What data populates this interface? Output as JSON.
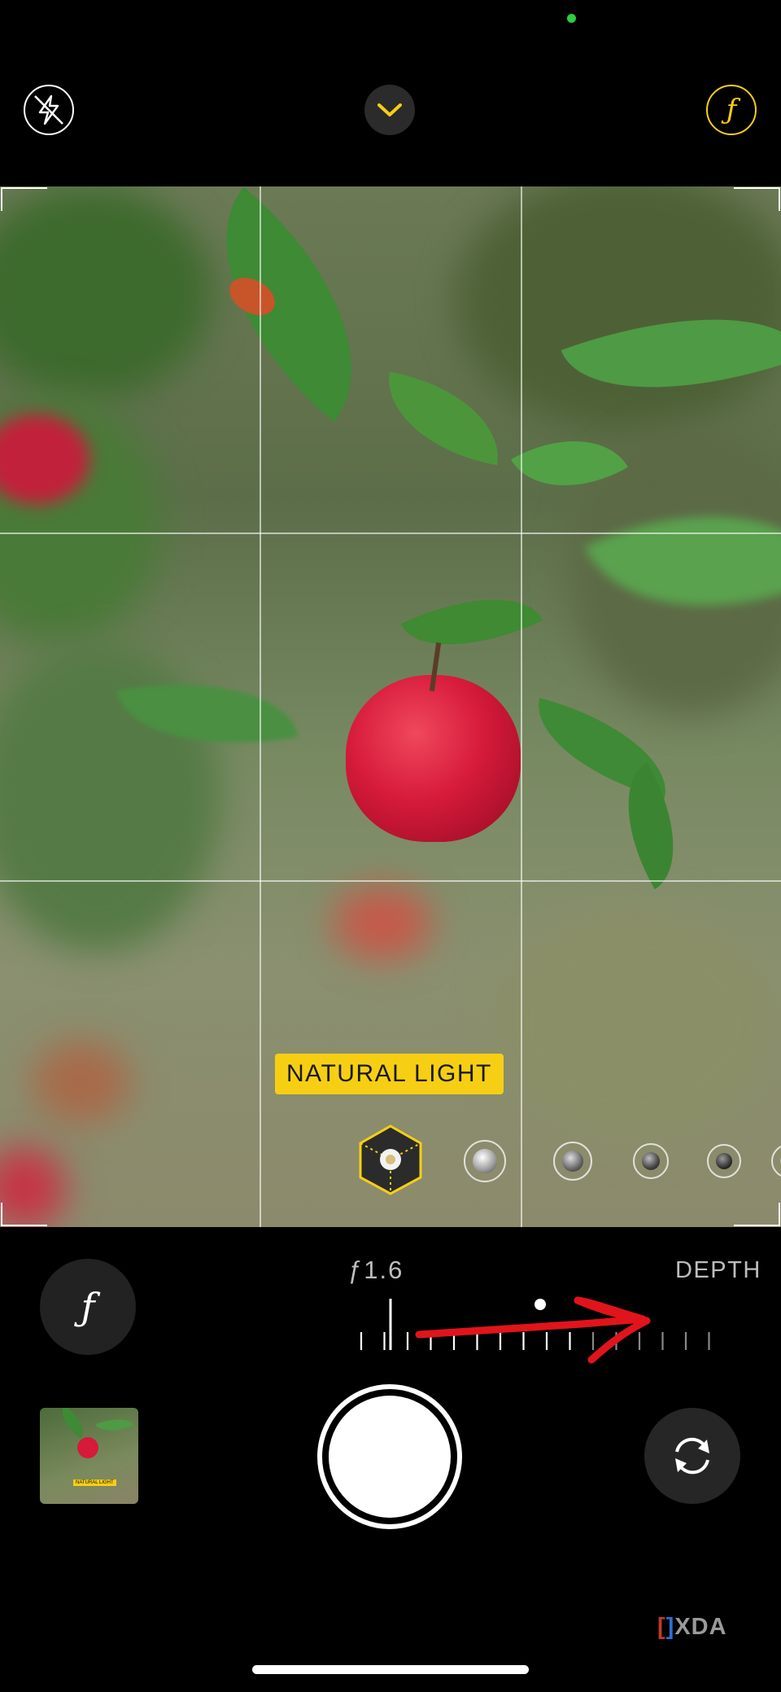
{
  "top_bar": {
    "flash_icon": "flash-off-icon",
    "toggle_icon": "chevron-down-icon",
    "aperture_glyph": "ƒ",
    "accent_color": "#f6cf14"
  },
  "viewfinder": {
    "lighting_mode_label": "NATURAL LIGHT",
    "lighting_modes": [
      "natural-light",
      "studio-light",
      "contour-light",
      "stage-light",
      "stage-light-mono",
      "high-key-light-mono"
    ]
  },
  "depth_control": {
    "aperture_glyph": "ƒ",
    "f_number": "ƒ1.6",
    "label": "DEPTH",
    "selected_fraction": 0.0
  },
  "annotation": {
    "color": "#e1141b",
    "meaning": "arrow"
  },
  "bottom_bar": {
    "thumbnail_label": "NATURAL LIGHT",
    "flip_icon": "camera-flip-icon"
  },
  "watermark": "XDA"
}
